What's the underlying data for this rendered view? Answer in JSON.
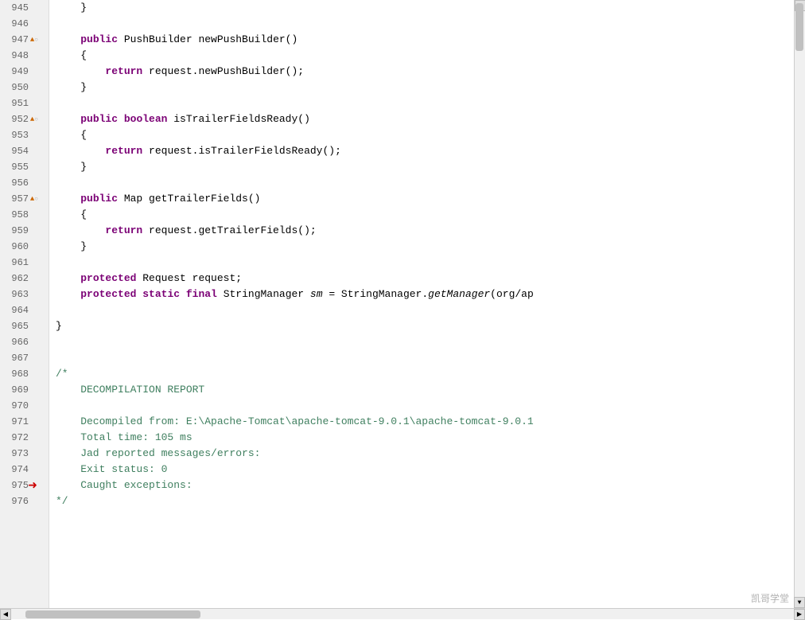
{
  "editor": {
    "lines": [
      {
        "num": 945,
        "content": "    }",
        "indent": 4,
        "type": "brace"
      },
      {
        "num": 946,
        "content": "",
        "type": "empty"
      },
      {
        "num": 947,
        "content": "",
        "type": "method-marker",
        "parts": [
          {
            "text": "    ",
            "cls": ""
          },
          {
            "text": "public",
            "cls": "kw-public"
          },
          {
            "text": " PushBuilder ",
            "cls": ""
          },
          {
            "text": "newPushBuilder",
            "cls": ""
          },
          {
            "text": "()",
            "cls": ""
          }
        ]
      },
      {
        "num": 948,
        "content": "    {",
        "type": "brace"
      },
      {
        "num": 949,
        "content": "",
        "type": "return-line",
        "parts": [
          {
            "text": "        ",
            "cls": ""
          },
          {
            "text": "return",
            "cls": "kw-return"
          },
          {
            "text": " request.newPushBuilder();",
            "cls": ""
          }
        ]
      },
      {
        "num": 950,
        "content": "    }",
        "type": "brace"
      },
      {
        "num": 951,
        "content": "",
        "type": "empty"
      },
      {
        "num": 952,
        "content": "",
        "type": "method-marker",
        "parts": [
          {
            "text": "    ",
            "cls": ""
          },
          {
            "text": "public",
            "cls": "kw-public"
          },
          {
            "text": " ",
            "cls": ""
          },
          {
            "text": "boolean",
            "cls": "kw-boolean"
          },
          {
            "text": " isTrailerFieldsReady()",
            "cls": ""
          }
        ]
      },
      {
        "num": 953,
        "content": "    {",
        "type": "brace"
      },
      {
        "num": 954,
        "content": "",
        "type": "return-line",
        "parts": [
          {
            "text": "        ",
            "cls": ""
          },
          {
            "text": "return",
            "cls": "kw-return"
          },
          {
            "text": " request.isTrailerFieldsReady();",
            "cls": ""
          }
        ]
      },
      {
        "num": 955,
        "content": "    }",
        "type": "brace"
      },
      {
        "num": 956,
        "content": "",
        "type": "empty"
      },
      {
        "num": 957,
        "content": "",
        "type": "method-marker",
        "parts": [
          {
            "text": "    ",
            "cls": ""
          },
          {
            "text": "public",
            "cls": "kw-public"
          },
          {
            "text": " Map getTrailerFields()",
            "cls": ""
          }
        ]
      },
      {
        "num": 958,
        "content": "    {",
        "type": "brace"
      },
      {
        "num": 959,
        "content": "",
        "type": "return-line",
        "parts": [
          {
            "text": "        ",
            "cls": ""
          },
          {
            "text": "return",
            "cls": "kw-return"
          },
          {
            "text": " request.getTrailerFields();",
            "cls": ""
          }
        ]
      },
      {
        "num": 960,
        "content": "    }",
        "type": "brace"
      },
      {
        "num": 961,
        "content": "",
        "type": "empty"
      },
      {
        "num": 962,
        "content": "",
        "type": "field-line",
        "parts": [
          {
            "text": "    ",
            "cls": ""
          },
          {
            "text": "protected",
            "cls": "kw-protected"
          },
          {
            "text": " Request request;",
            "cls": ""
          }
        ]
      },
      {
        "num": 963,
        "content": "",
        "type": "field-line",
        "parts": [
          {
            "text": "    ",
            "cls": ""
          },
          {
            "text": "protected",
            "cls": "kw-protected"
          },
          {
            "text": " ",
            "cls": ""
          },
          {
            "text": "static",
            "cls": "kw-static"
          },
          {
            "text": " ",
            "cls": ""
          },
          {
            "text": "final",
            "cls": "kw-final"
          },
          {
            "text": " StringManager ",
            "cls": ""
          },
          {
            "text": "sm",
            "cls": "italic"
          },
          {
            "text": " = StringManager.",
            "cls": ""
          },
          {
            "text": "getManager",
            "cls": "italic"
          },
          {
            "text": "(org/ap",
            "cls": ""
          }
        ]
      },
      {
        "num": 964,
        "content": "",
        "type": "empty"
      },
      {
        "num": 965,
        "content": "}",
        "type": "brace"
      },
      {
        "num": 966,
        "content": "",
        "type": "empty"
      },
      {
        "num": 967,
        "content": "",
        "type": "empty"
      },
      {
        "num": 968,
        "content": "/*",
        "type": "comment"
      },
      {
        "num": 969,
        "content": "    DECOMPILATION REPORT",
        "type": "comment"
      },
      {
        "num": 970,
        "content": "",
        "type": "empty"
      },
      {
        "num": 971,
        "content": "    Decompiled from: E:\\Apache-Tomcat\\apache-tomcat-9.0.1\\apache-tomcat-9.0.1",
        "type": "comment"
      },
      {
        "num": 972,
        "content": "    Total time: 105 ms",
        "type": "comment"
      },
      {
        "num": 973,
        "content": "    Jad reported messages/errors:",
        "type": "comment"
      },
      {
        "num": 974,
        "content": "    Exit status: 0",
        "type": "comment"
      },
      {
        "num": 975,
        "content": "    Caught exceptions:",
        "type": "comment",
        "arrow": true
      },
      {
        "num": 976,
        "content": "*/",
        "type": "comment"
      }
    ],
    "arrow_line": 975,
    "watermark": "凯哥学堂"
  }
}
